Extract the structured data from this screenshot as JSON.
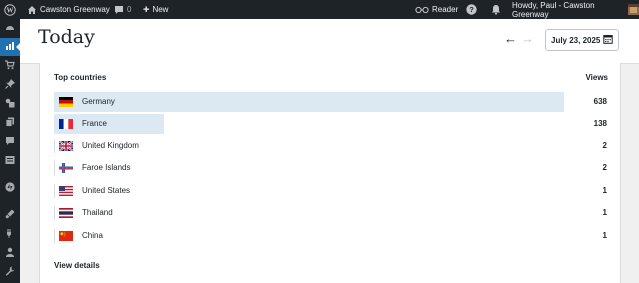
{
  "admin_bar": {
    "site_name": "Cawston Greenway",
    "comments_count": "0",
    "new_label": "New",
    "reader_label": "Reader",
    "howdy_label": "Howdy, Paul - Cawston Greenway"
  },
  "sidebar": {
    "items": [
      {
        "icon": "dashboard-icon"
      },
      {
        "icon": "stats-icon"
      },
      {
        "icon": "store-icon"
      },
      {
        "icon": "pin-icon"
      },
      {
        "icon": "media-icon"
      },
      {
        "icon": "pages-icon"
      },
      {
        "icon": "comments-icon"
      },
      {
        "icon": "feedback-icon"
      },
      {
        "icon": "jetpack-icon"
      },
      {
        "icon": "appearance-icon"
      },
      {
        "icon": "plugins-icon"
      },
      {
        "icon": "users-icon"
      },
      {
        "icon": "tools-icon"
      }
    ]
  },
  "header": {
    "title": "Today",
    "date": "July 23, 2025"
  },
  "top_countries": {
    "heading": "Top countries",
    "views_heading": "Views",
    "max_views": 638,
    "rows": [
      {
        "country": "Germany",
        "views": "638",
        "views_num": 638,
        "flag": "de"
      },
      {
        "country": "France",
        "views": "138",
        "views_num": 138,
        "flag": "fr"
      },
      {
        "country": "United Kingdom",
        "views": "2",
        "views_num": 2,
        "flag": "gb"
      },
      {
        "country": "Faroe Islands",
        "views": "2",
        "views_num": 2,
        "flag": "fo"
      },
      {
        "country": "United States",
        "views": "1",
        "views_num": 1,
        "flag": "us"
      },
      {
        "country": "Thailand",
        "views": "1",
        "views_num": 1,
        "flag": "th"
      },
      {
        "country": "China",
        "views": "1",
        "views_num": 1,
        "flag": "cn"
      }
    ],
    "view_details_label": "View details"
  },
  "colors": {
    "admin_bar_bg": "#1d2327",
    "accent": "#2271b1",
    "bar_fill": "#dce9f3"
  }
}
